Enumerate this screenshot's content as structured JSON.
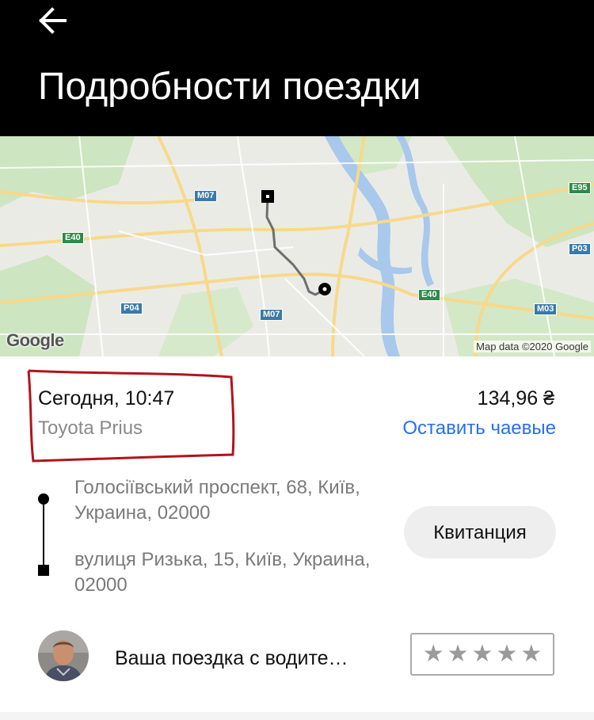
{
  "header": {
    "title": "Подробности поездки",
    "back_icon": "arrow-left-icon"
  },
  "map": {
    "attribution": "Map data ©2020 Google",
    "logo_text": "Google",
    "road_labels": [
      "M07",
      "E95",
      "E40",
      "P03",
      "E40",
      "P04",
      "M07",
      "M03"
    ]
  },
  "trip": {
    "date_time": "Сегодня, 10:47",
    "vehicle": "Toyota Prius",
    "price": "134,96 ₴",
    "tip_link": "Оставить чаевые"
  },
  "route": {
    "from": "Голосіївський проспект, 68, Київ, Украина, 02000",
    "to": "вулиця Ризька, 15, Київ, Украина, 02000"
  },
  "receipt": {
    "label": "Квитанция"
  },
  "driver": {
    "text": "Ваша поездка с водите…",
    "rating": {
      "max": 5,
      "value": 0,
      "star_glyph": "★"
    }
  },
  "colors": {
    "header_bg": "#000000",
    "accent_link": "#276ef1",
    "annotation": "#b0141c"
  }
}
